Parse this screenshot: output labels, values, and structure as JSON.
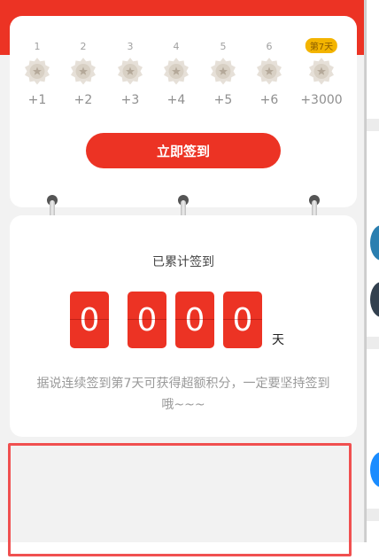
{
  "calendar": {
    "days": [
      {
        "label": "1",
        "points": "+1"
      },
      {
        "label": "2",
        "points": "+2"
      },
      {
        "label": "3",
        "points": "+3"
      },
      {
        "label": "4",
        "points": "+4"
      },
      {
        "label": "5",
        "points": "+5"
      },
      {
        "label": "6",
        "points": "+6"
      },
      {
        "label": "第7天",
        "points": "+3000",
        "highlight": true
      }
    ],
    "checkin_button": "立即签到"
  },
  "summary": {
    "label": "已累计签到",
    "digits": [
      "0",
      "0",
      "0",
      "0"
    ],
    "unit": "天",
    "tip": "据说连续签到第7天可获得超额积分，一定要坚持签到哦~~~"
  },
  "colors": {
    "accent": "#ec3324",
    "badge": "#f3b400",
    "highlight_border": "#f05050"
  },
  "icons": {
    "day_icon": "star-badge-icon"
  }
}
